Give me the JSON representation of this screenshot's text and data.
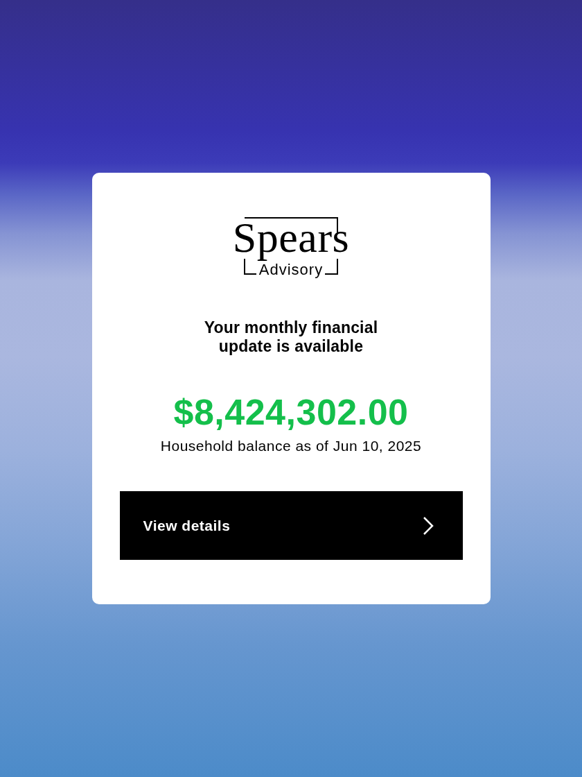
{
  "logo": {
    "wordmark": "Spears",
    "subtitle": "Advisory"
  },
  "message": {
    "headline": "Your monthly financial update is available",
    "amount": "$8,424,302.00",
    "caption": "Household balance as of Jun 10, 2025"
  },
  "action": {
    "label": "View details"
  }
}
